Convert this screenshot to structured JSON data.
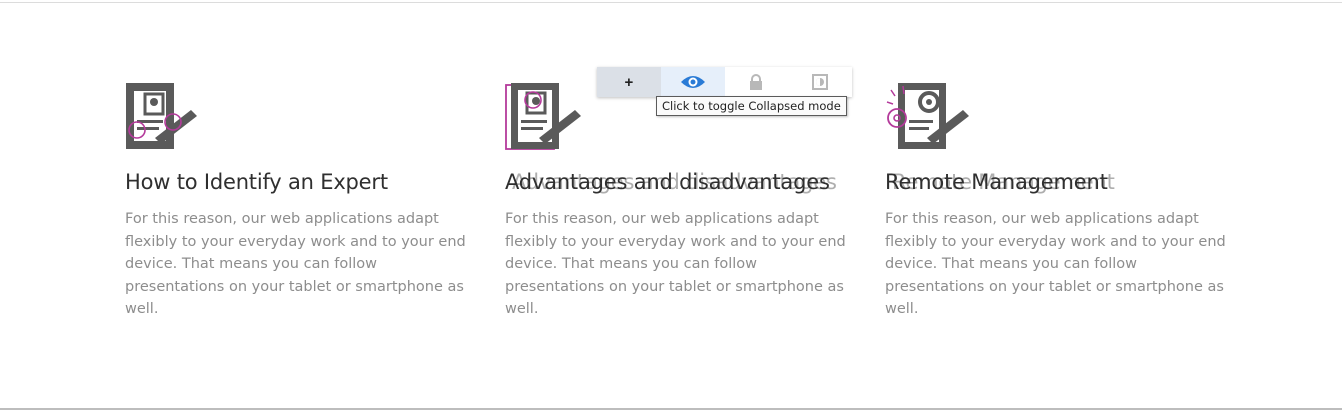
{
  "features": [
    {
      "title": "How to Identify an Expert",
      "ghost_title": "",
      "lines": [
        "For this reason, our web applications adapt",
        "flexibly to your everyday work and to your end",
        "device. That means you can follow",
        "presentations on your tablet or smartphone as",
        "well."
      ]
    },
    {
      "title": "Advantages and disadvantages",
      "ghost_title": "Advantages and disadvantages",
      "lines": [
        "For this reason, our web applications adapt",
        "flexibly to your everyday work and to your end",
        "device. That means you can follow",
        "presentations on your tablet or smartphone as",
        "well."
      ]
    },
    {
      "title": "Remote Management",
      "ghost_title": "Remote Management",
      "lines": [
        "For this reason, our web applications adapt",
        "flexibly to your everyday work and to your end",
        "device. That means you can follow",
        "presentations on your tablet or smartphone as",
        "well."
      ]
    }
  ],
  "toolbar": {
    "add_label": "+",
    "tooltip": "Click to toggle Collapsed mode",
    "icons": [
      "eye-icon",
      "lock-icon",
      "theme-icon"
    ],
    "accent": "#2a7bd6"
  },
  "colors": {
    "heading": "#2f2f2f",
    "body": "#8d8d8d",
    "icon_gray": "#5a5a5a",
    "icon_purple": "#b43a9b"
  }
}
